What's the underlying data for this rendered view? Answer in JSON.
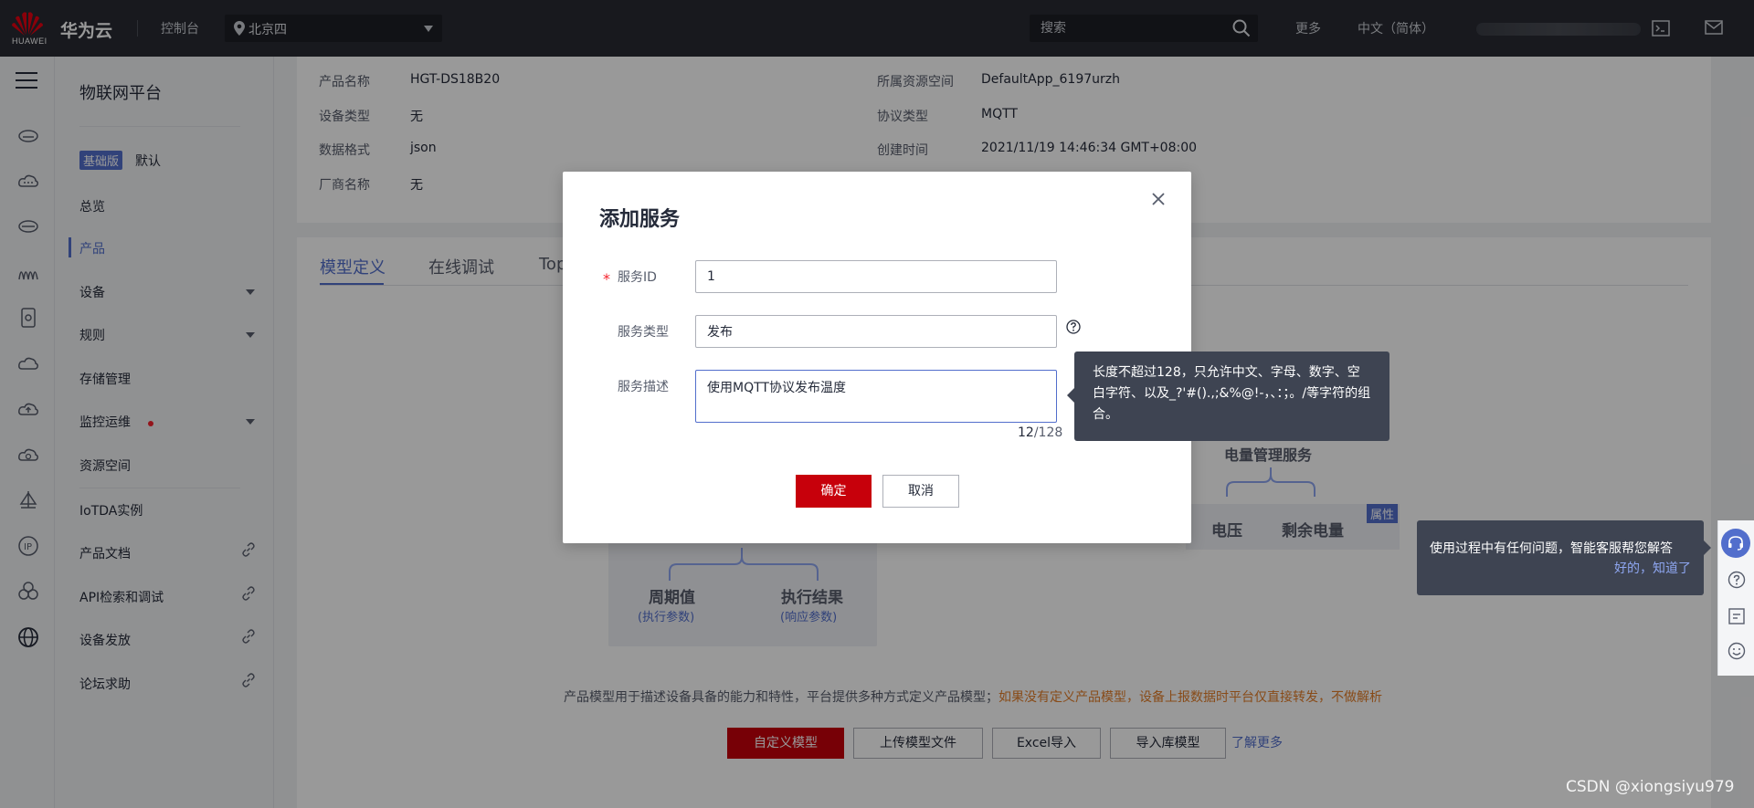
{
  "topbar": {
    "logo_text": "HUAWEI",
    "brand": "华为云",
    "console": "控制台",
    "region": "北京四",
    "search_placeholder": "搜索",
    "more": "更多",
    "language": "中文（简体）"
  },
  "nav": {
    "title": "物联网平台",
    "edition_badge": "基础版",
    "edition_default": "默认",
    "items": [
      {
        "label": "总览"
      },
      {
        "label": "产品"
      },
      {
        "label": "设备"
      },
      {
        "label": "规则"
      },
      {
        "label": "存储管理"
      },
      {
        "label": "监控运维"
      },
      {
        "label": "资源空间"
      },
      {
        "label": "IoTDA实例"
      },
      {
        "label": "产品文档"
      },
      {
        "label": "API检索和调试"
      },
      {
        "label": "设备发放"
      },
      {
        "label": "论坛求助"
      }
    ]
  },
  "product_info": {
    "name_label": "产品名称",
    "name_value": "HGT-DS18B20",
    "type_label": "设备类型",
    "type_value": "无",
    "format_label": "数据格式",
    "format_value": "json",
    "vendor_label": "厂商名称",
    "vendor_value": "无",
    "space_label": "所属资源空间",
    "space_value": "DefaultApp_6197urzh",
    "protocol_label": "协议类型",
    "protocol_value": "MQTT",
    "created_label": "创建时间",
    "created_value": "2021/11/19 14:46:34 GMT+08:00"
  },
  "tabs": [
    "模型定义",
    "在线调试",
    "Top"
  ],
  "diagram": {
    "right_title": "电量管理服务",
    "attr_tag": "属性",
    "voltage": "电压",
    "battery": "剩余电量",
    "period": "周期值",
    "period_sub": "(执行参数)",
    "result": "执行结果",
    "result_sub": "(响应参数)"
  },
  "footer": {
    "desc": "产品模型用于描述设备具备的能力和特性，平台提供多种方式定义产品模型；",
    "warn": "如果没有定义产品模型，设备上报数据时平台仅直接转发，不做解析",
    "btn_custom": "自定义模型",
    "btn_upload": "上传模型文件",
    "btn_excel": "Excel导入",
    "btn_import_lib": "导入库模型",
    "learn_more": "了解更多"
  },
  "dialog": {
    "title": "添加服务",
    "service_id_label": "服务ID",
    "service_id_value": "1",
    "service_type_label": "服务类型",
    "service_type_value": "发布",
    "service_desc_label": "服务描述",
    "service_desc_value": "使用MQTT协议发布温度",
    "counter_current": "12",
    "counter_max": "/128",
    "ok": "确定",
    "cancel": "取消"
  },
  "tooltip": {
    "text": "长度不超过128，只允许中文、字母、数字、空白字符、以及_?'#().,;&%@!-，、：；。/等字符的组合。"
  },
  "cs_tip": {
    "text": "使用过程中有任何问题，智能客服帮您解答",
    "ack": "好的，知道了"
  },
  "watermark": "CSDN @xiongsiyu979",
  "colors": {
    "primary_red": "#c7000b",
    "accent_blue": "#526ecc",
    "topbar_bg": "#282b33",
    "tooltip_bg": "#3e4452"
  }
}
